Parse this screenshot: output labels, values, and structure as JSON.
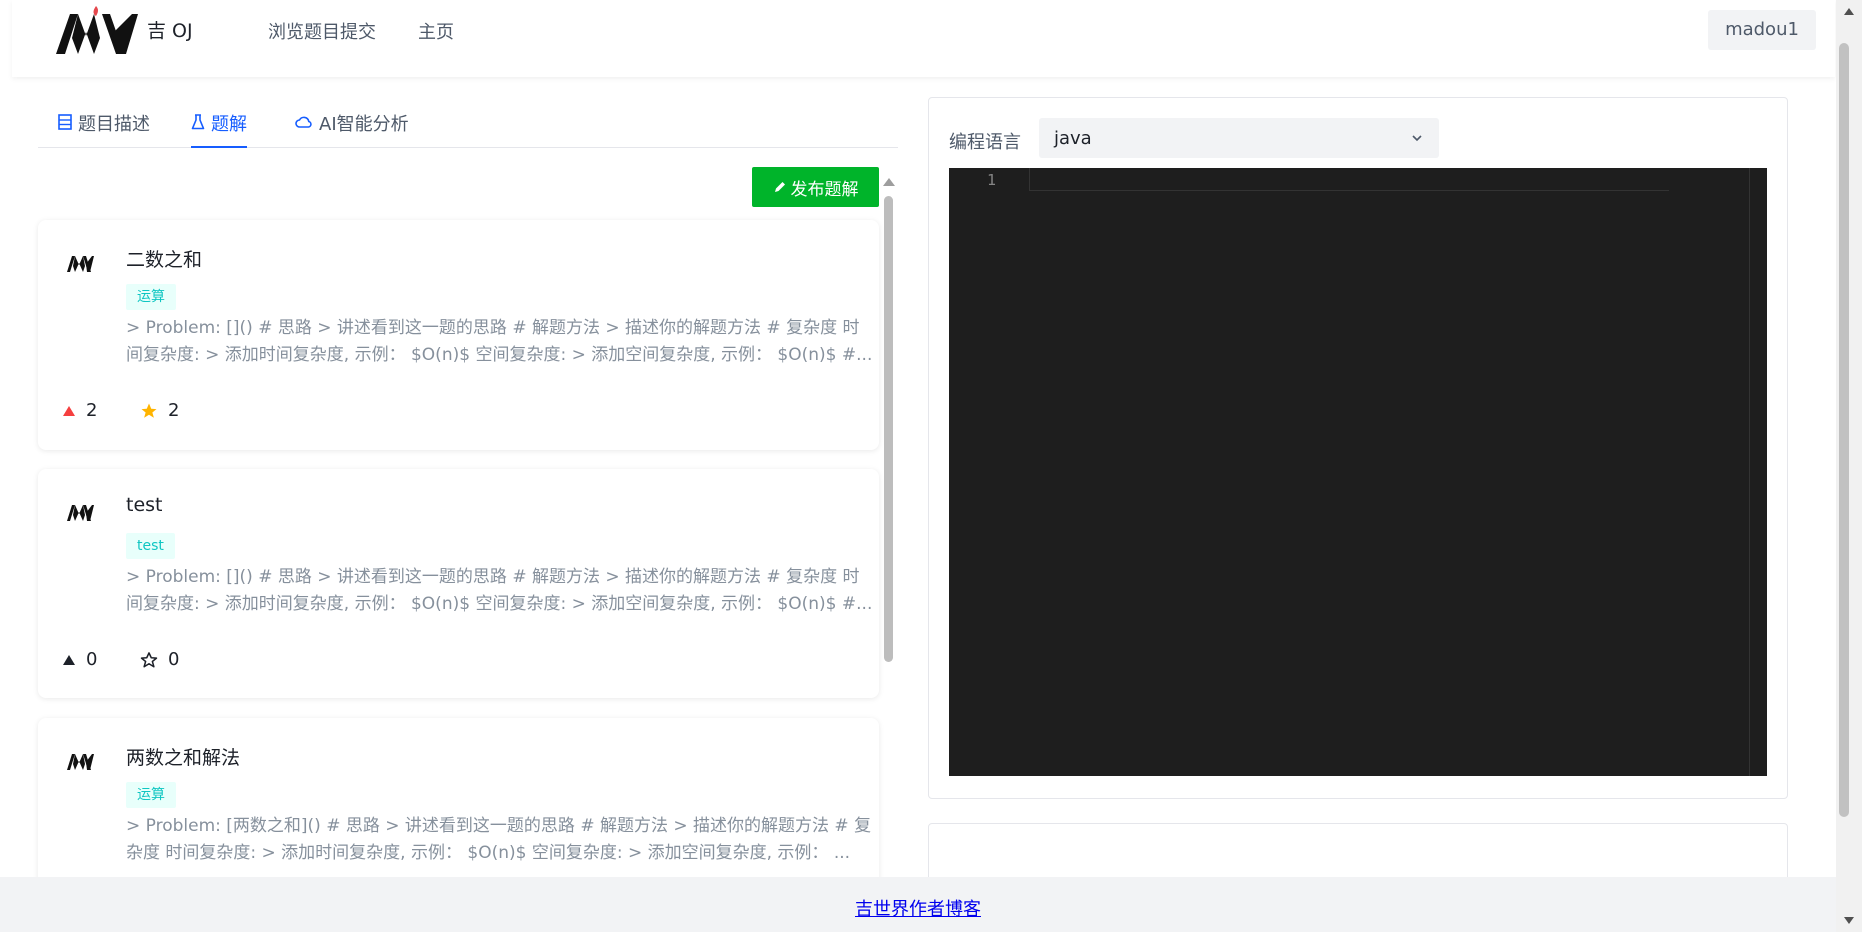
{
  "header": {
    "brand": "吉 OJ",
    "nav": [
      "浏览题目提交",
      "主页"
    ],
    "user": "madou1"
  },
  "tabs": [
    {
      "label": "题目描述",
      "icon": "list-icon"
    },
    {
      "label": "题解",
      "icon": "flask-icon"
    },
    {
      "label": "AI智能分析",
      "icon": "cloud-icon"
    }
  ],
  "publish_button": "发布题解",
  "solutions": [
    {
      "title": "二数之和",
      "tag": "运算",
      "summary": "> Problem: []() # 思路 > 讲述看到这一题的思路 # 解题方法 > 描述你的解题方法 # 复杂度 时间复杂度: > 添加时间复杂度, 示例： $O(n)$ 空间复杂度: > 添加空间复杂度, 示例： $O(n)$ #...",
      "likes": "2",
      "stars": "2",
      "liked": true,
      "starred": true
    },
    {
      "title": "test",
      "tag": "test",
      "summary": "> Problem: []() # 思路 > 讲述看到这一题的思路 # 解题方法 > 描述你的解题方法 # 复杂度 时间复杂度: > 添加时间复杂度, 示例： $O(n)$ 空间复杂度: > 添加空间复杂度, 示例： $O(n)$ #...",
      "likes": "0",
      "stars": "0",
      "liked": false,
      "starred": false
    },
    {
      "title": "两数之和解法",
      "tag": "运算",
      "summary": "> Problem: [两数之和]() # 思路 > 讲述看到这一题的思路 # 解题方法 > 描述你的解题方法 # 复杂度 时间复杂度: > 添加时间复杂度, 示例： $O(n)$ 空间复杂度: > 添加空间复杂度, 示例： ..."
    }
  ],
  "editor": {
    "language_label": "编程语言",
    "language": "java",
    "line_number": "1"
  },
  "footer_link": "吉世界作者博客",
  "colors": {
    "accent": "#165dff",
    "publish_green": "#00b42a",
    "like_red": "#f53f3f",
    "star_gold": "#ffb400",
    "tag_text": "#0fc6c2",
    "tag_bg": "#e8fffb",
    "editor_bg": "#1e1e1e"
  }
}
